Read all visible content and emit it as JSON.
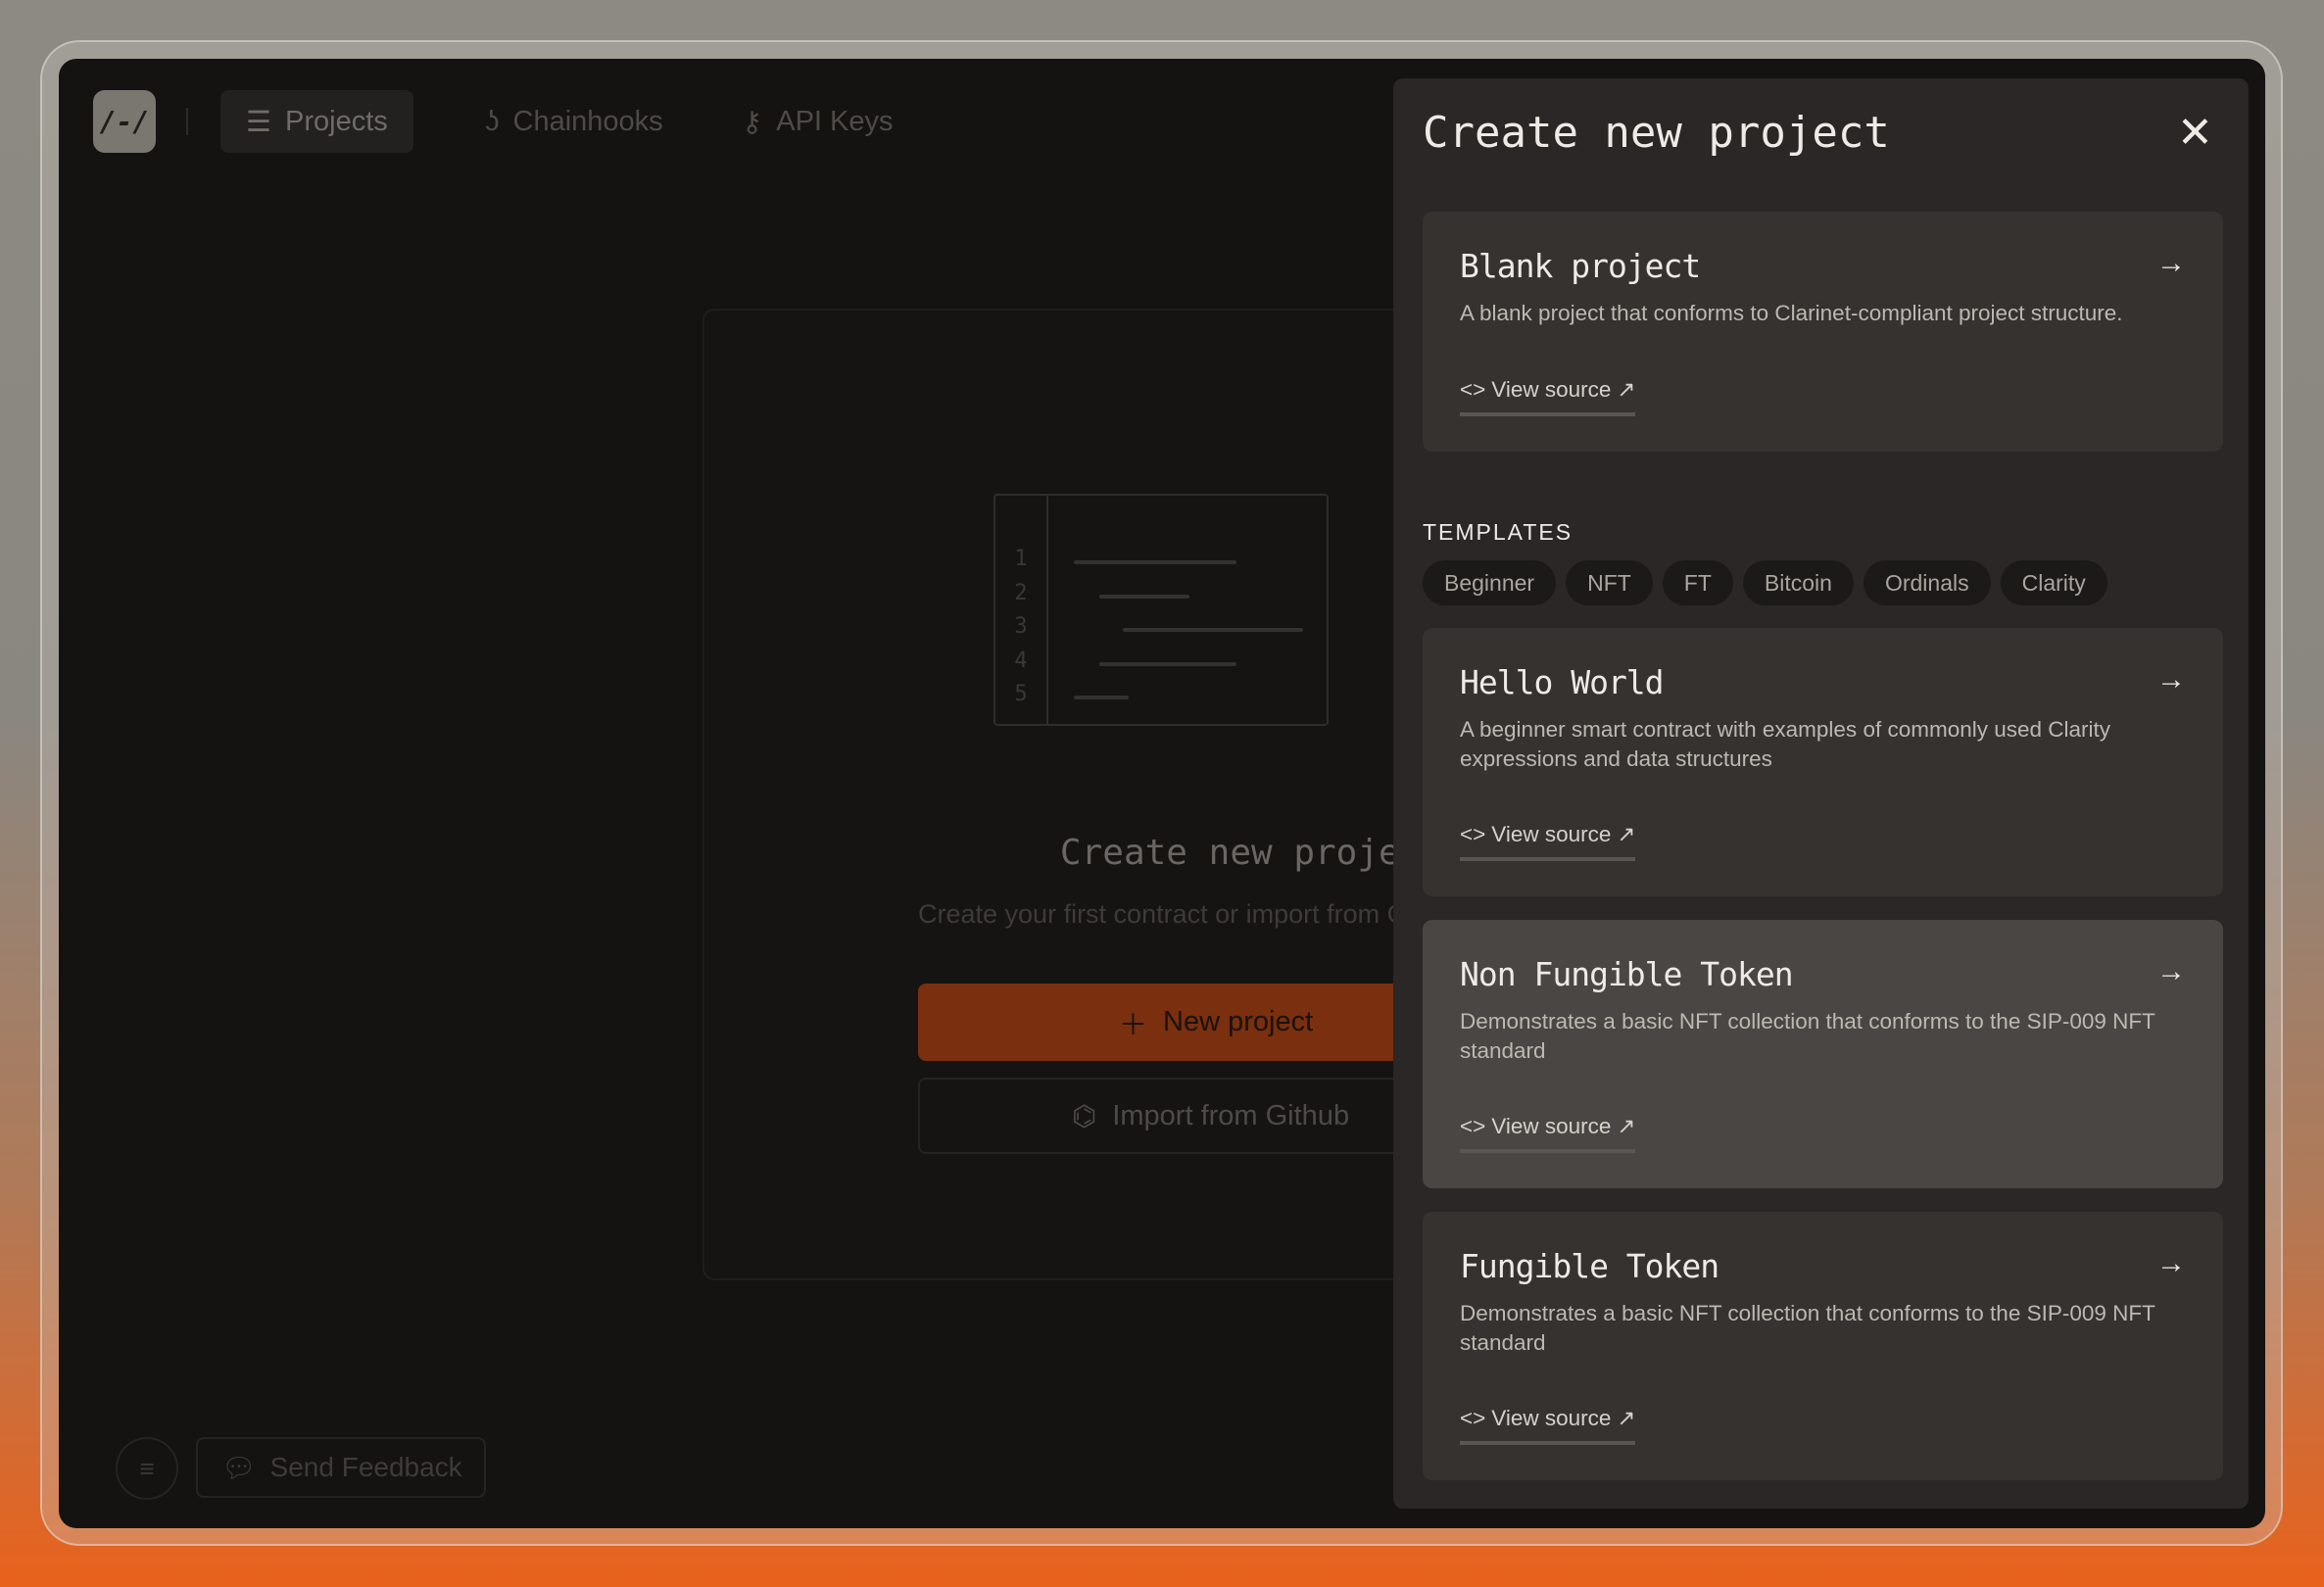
{
  "nav": {
    "logo": "/-/",
    "items": [
      {
        "label": "Projects",
        "icon": "list-icon"
      },
      {
        "label": "Chainhooks",
        "icon": "hook-icon"
      },
      {
        "label": "API Keys",
        "icon": "key-icon"
      }
    ]
  },
  "empty_state": {
    "line_numbers": [
      "1",
      "2",
      "3",
      "4",
      "5"
    ],
    "title": "Create new project",
    "subtitle": "Create your first contract or import from GitHub",
    "new_button": "New project",
    "import_button": "Import from Github"
  },
  "footer": {
    "feedback": "Send Feedback"
  },
  "panel": {
    "title": "Create new project",
    "blank": {
      "title": "Blank project",
      "desc": "A blank project that conforms to Clarinet-compliant project structure.",
      "link": "View source"
    },
    "templates_label": "TEMPLATES",
    "chips": [
      "Beginner",
      "NFT",
      "FT",
      "Bitcoin",
      "Ordinals",
      "Clarity"
    ],
    "templates": [
      {
        "title": "Hello World",
        "desc": "A beginner smart contract with examples of commonly used Clarity expressions and data structures",
        "link": "View source"
      },
      {
        "title": "Non Fungible Token",
        "desc": "Demonstrates a basic NFT collection that conforms to the SIP-009 NFT standard",
        "link": "View source"
      },
      {
        "title": "Fungible Token",
        "desc": "Demonstrates a basic NFT collection that conforms to the SIP-009 NFT standard",
        "link": "View source"
      }
    ]
  }
}
